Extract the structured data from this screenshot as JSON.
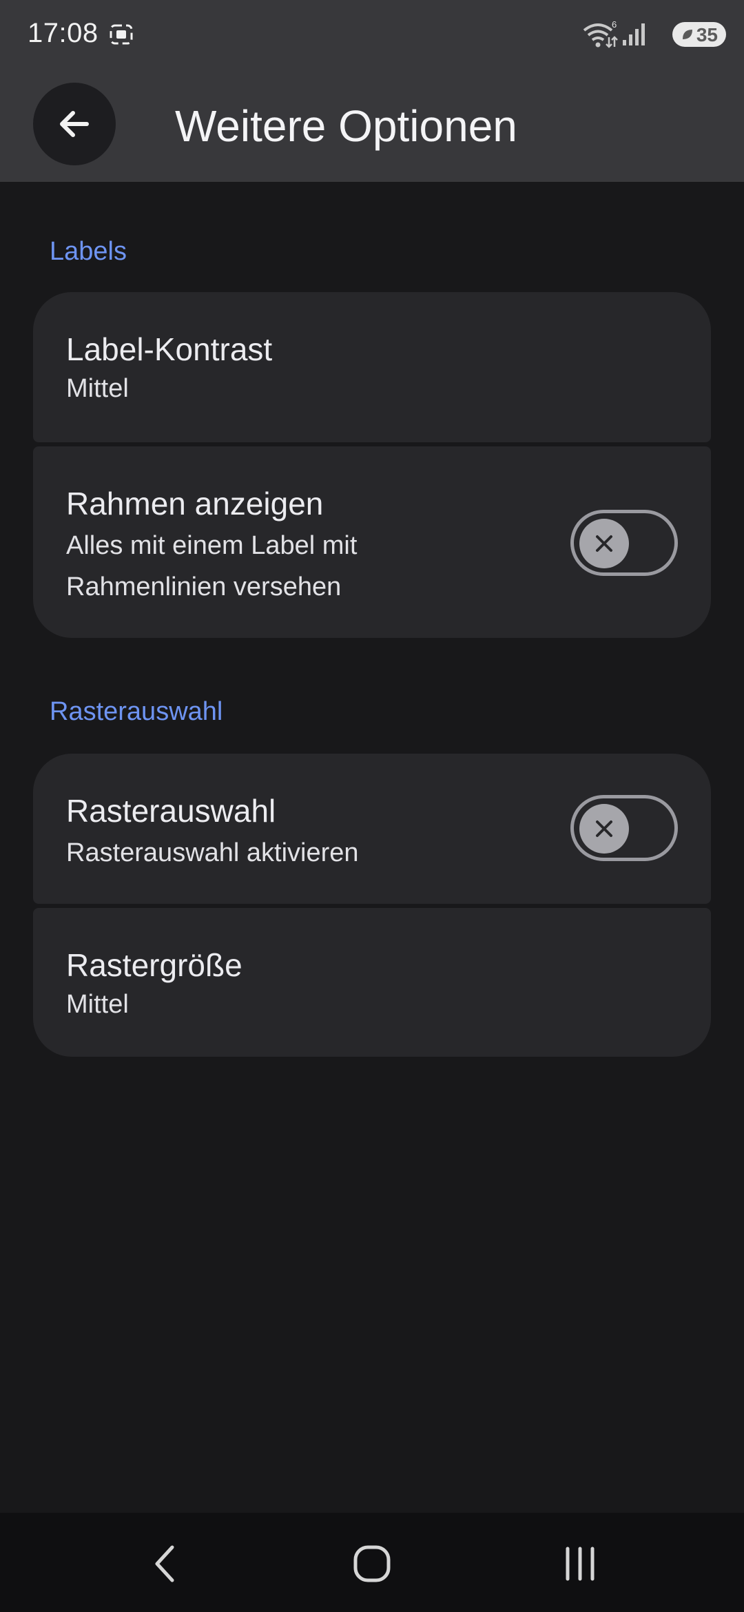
{
  "status_bar": {
    "time": "17:08",
    "wifi_badge": "6",
    "battery_level": "35",
    "icons": [
      "screenshot-icon",
      "wifi-icon",
      "signal-icon",
      "battery-icon"
    ]
  },
  "app_bar": {
    "back_icon": "arrow-left-icon",
    "title": "Weitere Optionen"
  },
  "sections": [
    {
      "header": "Labels",
      "items": [
        {
          "title": "Label-Kontrast",
          "subtitle": "Mittel"
        },
        {
          "title": "Rahmen anzeigen",
          "subtitle_line1": "Alles mit einem Label mit",
          "subtitle_line2": "Rahmenlinien versehen",
          "toggle_on": false
        }
      ]
    },
    {
      "header": "Rasterauswahl",
      "items": [
        {
          "title": "Rasterauswahl",
          "subtitle": "Rasterauswahl aktivieren",
          "toggle_on": false
        },
        {
          "title": "Rastergröße",
          "subtitle": "Mittel"
        }
      ]
    }
  ],
  "nav_bar": {
    "buttons": [
      "back-icon",
      "home-icon",
      "recents-icon"
    ]
  },
  "colors": {
    "background": "#18181a",
    "app_bar": "#38383b",
    "card": "#27272a",
    "accent": "#6e94f2"
  }
}
